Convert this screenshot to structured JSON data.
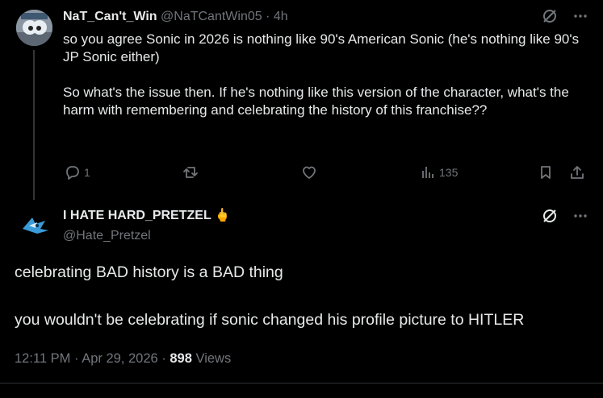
{
  "reply_tweet": {
    "display_name": "NaT_Can't_Win",
    "handle": "@NaTCantWin05",
    "separator": "·",
    "time_ago": "4h",
    "paragraphs": [
      "so you agree Sonic in 2026 is nothing like 90's American Sonic (he's nothing like 90's JP Sonic either)",
      "So what's the issue then. If he's nothing like this version of the character, what's the harm with remembering and celebrating the history of this franchise??"
    ],
    "actions": {
      "reply_count": "1",
      "views_count": "135"
    }
  },
  "main_tweet": {
    "display_name": "I HATE HARD_PRETZEL",
    "name_emoji": "🖕",
    "handle": "@Hate_Pretzel",
    "paragraphs": [
      "celebrating BAD history is a BAD thing",
      "you wouldn't be celebrating if sonic changed his profile picture to HITLER"
    ],
    "time": "12:11 PM",
    "date": "Apr 29, 2026",
    "separator": "·",
    "views_count": "898",
    "views_label": "Views"
  },
  "colors": {
    "background": "#000000",
    "text": "#e7e9ea",
    "muted": "#71767b",
    "divider": "#2f3336"
  },
  "icons": [
    "grok-icon",
    "more-icon",
    "reply-icon",
    "retweet-icon",
    "like-icon",
    "views-icon",
    "bookmark-icon",
    "share-icon"
  ]
}
